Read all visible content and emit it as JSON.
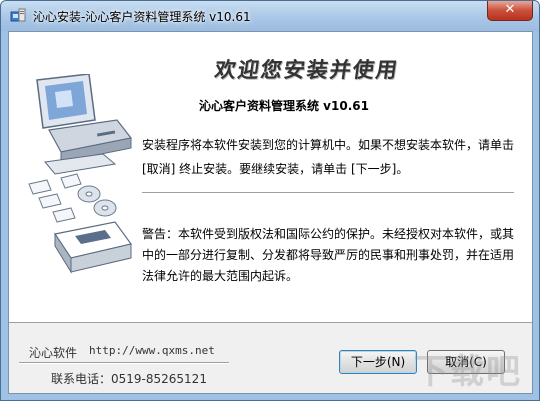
{
  "window": {
    "title": "沁心安装-沁心客户资料管理系统 v10.61",
    "close_glyph": "✕"
  },
  "content": {
    "heading": "欢迎您安装并使用",
    "product": "沁心客户资料管理系统 v10.61",
    "intro": "安装程序将本软件安装到您的计算机中。如果不想安装本软件，请单击[取消] 终止安装。要继续安装，请单击 [下一步]。",
    "warning": "警告：本软件受到版权法和国际公约的保护。未经授权对本软件，或其中的一部分进行复制、分发都将导致严厉的民事和刑事处罚，并在适用法律允许的最大范围内起诉。"
  },
  "footer": {
    "company": "沁心软件",
    "url": "http://www.qxms.net",
    "phone": "联系电话：0519-85265121"
  },
  "buttons": {
    "next": "下一步(N)",
    "cancel": "取消(C)"
  },
  "watermark": "下载吧",
  "icons": [
    "installer-app-icon",
    "computer-illustration-icon",
    "close-icon"
  ]
}
